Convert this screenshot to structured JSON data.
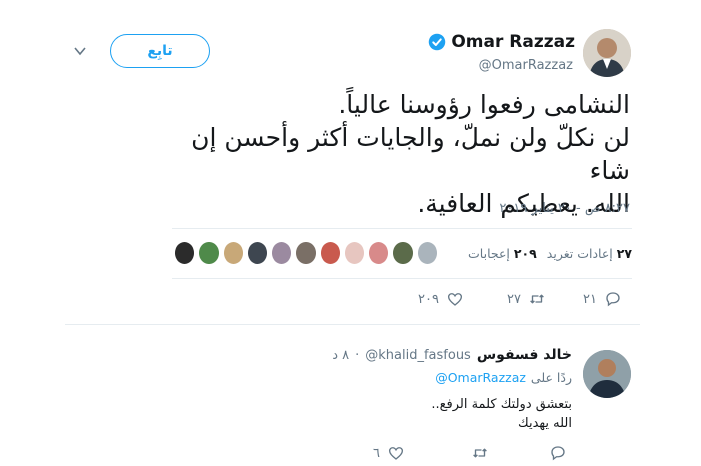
{
  "author": {
    "name": "Omar Razzaz",
    "handle": "@OmarRazzaz",
    "follow_label": "تابِع"
  },
  "tweet": {
    "lines": [
      "النشامى رفعوا رؤوسنا عالياً.",
      "لن نكلّ ولن نملّ، والجايات أكثر وأحسن إن شاء",
      "الله. يعطيكم العافية."
    ],
    "timestamp": "٨:٢٧ ص - ٢٠ يناير ٢٠١٩"
  },
  "stats": {
    "retweets_count": "٢٧",
    "retweets_label": "إعادات تغريد",
    "likes_count": "٢٠٩",
    "likes_label": "إعجابات"
  },
  "actions": {
    "reply_count": "٢١",
    "retweet_count": "٢٧",
    "like_count": "٢٠٩"
  },
  "reply": {
    "name": "خالد فسفوس",
    "handle": "@khalid_fasfous",
    "time": "٨ د",
    "replying_prefix": "ردًا على",
    "replying_to": "@OmarRazzaz",
    "lines": [
      "بتعشق دولتك كلمة الرفع..",
      "الله يهديك"
    ],
    "reply_count": "",
    "retweet_count": "",
    "like_count": "٦"
  },
  "colors": {
    "accent": "#1da1f2",
    "muted": "#657786",
    "divider": "#e6ecf0"
  }
}
